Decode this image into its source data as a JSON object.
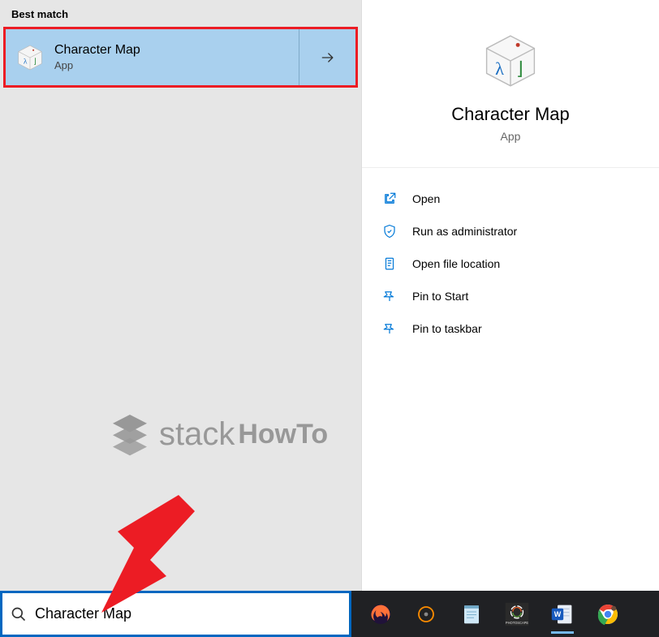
{
  "left": {
    "section_header": "Best match",
    "result": {
      "title": "Character Map",
      "subtitle": "App"
    }
  },
  "detail": {
    "title": "Character Map",
    "subtitle": "App",
    "actions": [
      {
        "label": "Open"
      },
      {
        "label": "Run as administrator"
      },
      {
        "label": "Open file location"
      },
      {
        "label": "Pin to Start"
      },
      {
        "label": "Pin to taskbar"
      }
    ]
  },
  "watermark": {
    "text1": "stack",
    "text2": "HowTo"
  },
  "search": {
    "value": "Character Map"
  }
}
